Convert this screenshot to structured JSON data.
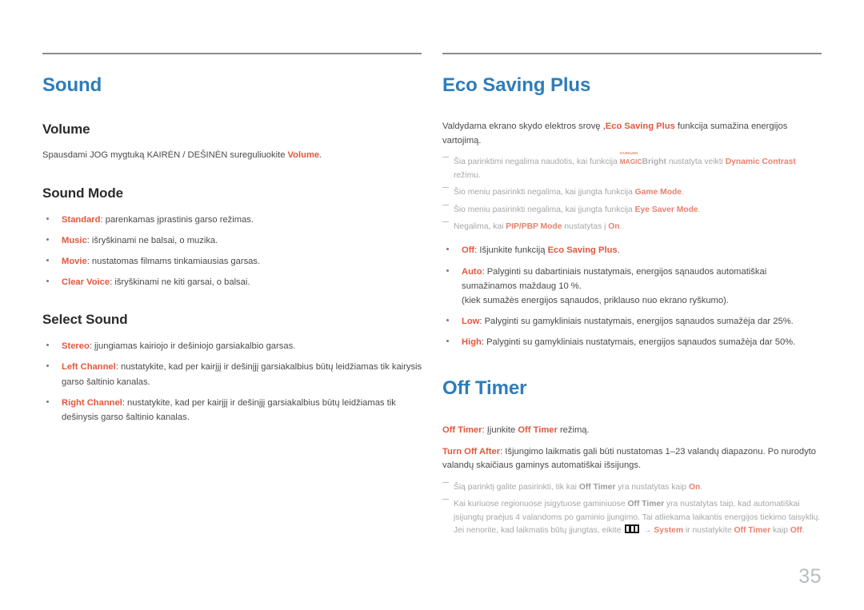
{
  "page": {
    "number": "35"
  },
  "left_column": {
    "section_title": "Sound",
    "volume": {
      "heading": "Volume",
      "body_pre": "Spausdami JOG mygtuką KAIRĖN / DEŠINĖN sureguliuokite ",
      "body_accent": "Volume",
      "body_post": "."
    },
    "sound_mode": {
      "heading": "Sound Mode",
      "items": [
        {
          "term": "Standard",
          "desc": ": parenkamas įprastinis garso režimas."
        },
        {
          "term": "Music",
          "desc": ": išryškinami ne balsai, o muzika."
        },
        {
          "term": "Movie",
          "desc": ": nustatomas filmams tinkamiausias garsas."
        },
        {
          "term": "Clear Voice",
          "desc": ": išryškinami ne kiti garsai, o balsai."
        }
      ]
    },
    "select_sound": {
      "heading": "Select Sound",
      "items": [
        {
          "term": "Stereo",
          "desc": ": įjungiamas kairiojo ir dešiniojo garsiakalbio garsas."
        },
        {
          "term": "Left Channel",
          "desc": ": nustatykite, kad per kairįjį ir dešinįjį garsiakalbius būtų leidžiamas tik kairysis garso šaltinio kanalas."
        },
        {
          "term": "Right Channel",
          "desc": ": nustatykite, kad per kairįjį ir dešinįjį garsiakalbius būtų leidžiamas tik dešinysis garso šaltinio kanalas."
        }
      ]
    }
  },
  "right_column": {
    "eco": {
      "section_title": "Eco Saving Plus",
      "intro_pre": "Valdydama ekrano skydo elektros srovę ,",
      "intro_accent": "Eco Saving Plus",
      "intro_post": " funkcija sumažina energijos vartojimą.",
      "notes": [
        {
          "parts": [
            {
              "t": "Šia parinktimi negalima naudotis, kai funkcija ",
              "style": "plain"
            },
            {
              "t": "MAGICBright",
              "style": "magic"
            },
            {
              "t": " nustatyta veikti ",
              "style": "plain"
            },
            {
              "t": "Dynamic Contrast",
              "style": "strong"
            },
            {
              "t": " režimu.",
              "style": "plain"
            }
          ]
        },
        {
          "parts": [
            {
              "t": "Šio meniu pasirinkti negalima, kai įjungta funkcija ",
              "style": "plain"
            },
            {
              "t": "Game Mode",
              "style": "accent"
            },
            {
              "t": ".",
              "style": "plain"
            }
          ]
        },
        {
          "parts": [
            {
              "t": "Šio meniu pasirinkti negalima, kai įjungta funkcija ",
              "style": "plain"
            },
            {
              "t": "Eye Saver Mode",
              "style": "accent"
            },
            {
              "t": ".",
              "style": "plain"
            }
          ]
        },
        {
          "parts": [
            {
              "t": "Negalima, kai ",
              "style": "plain"
            },
            {
              "t": "PIP/PBP Mode",
              "style": "accent"
            },
            {
              "t": " nustatytas į ",
              "style": "plain"
            },
            {
              "t": "On",
              "style": "accent"
            },
            {
              "t": ".",
              "style": "plain"
            }
          ]
        }
      ],
      "items": [
        {
          "term": "Off",
          "desc_pre": ": Išjunkite funkciją ",
          "desc_accent": "Eco Saving Plus",
          "desc_post": ".",
          "sub": ""
        },
        {
          "term": "Auto",
          "desc_pre": ": Palyginti su dabartiniais nustatymais, energijos sąnaudos automatiškai sumažinamos maždaug 10 %.",
          "desc_accent": "",
          "desc_post": "",
          "sub": "(kiek sumažės energijos sąnaudos, priklauso nuo ekrano ryškumo)."
        },
        {
          "term": "Low",
          "desc_pre": ": Palyginti su gamykliniais nustatymais, energijos sąnaudos sumažėja dar 25%.",
          "desc_accent": "",
          "desc_post": "",
          "sub": ""
        },
        {
          "term": "High",
          "desc_pre": ": Palyginti su gamykliniais nustatymais, energijos sąnaudos sumažėja dar 50%.",
          "desc_accent": "",
          "desc_post": "",
          "sub": ""
        }
      ]
    },
    "off_timer": {
      "section_title": "Off Timer",
      "para1": {
        "term": "Off Timer",
        "pre": ": Įjunkite ",
        "accent": "Off Timer",
        "post": " režimą."
      },
      "para2": {
        "term": "Turn Off After",
        "text": ": Išjungimo laikmatis gali būti nustatomas 1–23 valandų diapazonu. Po nurodyto valandų skaičiaus gaminys automatiškai išsijungs."
      },
      "notes": [
        {
          "parts": [
            {
              "t": "Šią parinktį galite pasirinkti, tik kai ",
              "style": "plain"
            },
            {
              "t": "Off Timer",
              "style": "strong"
            },
            {
              "t": " yra nustatytas kaip ",
              "style": "plain"
            },
            {
              "t": "On",
              "style": "accent"
            },
            {
              "t": ".",
              "style": "plain"
            }
          ]
        },
        {
          "parts": [
            {
              "t": "Kai kuriuose regionuose įsigytuose gaminiuose ",
              "style": "plain"
            },
            {
              "t": "Off Timer",
              "style": "strong"
            },
            {
              "t": " yra nustatytas taip, kad automatiškai įsijungtų praėjus 4 valandoms po gaminio įjungimo. Tai atliekama laikantis energijos tiekimo taisyklių. Jei nenorite, kad laikmatis būtų įjungtas, eikite ",
              "style": "plain"
            },
            {
              "t": "menu-icon",
              "style": "icon"
            },
            {
              "t": " → ",
              "style": "plain"
            },
            {
              "t": "System",
              "style": "accent"
            },
            {
              "t": " ir nustatykite ",
              "style": "plain"
            },
            {
              "t": "Off Timer",
              "style": "accent"
            },
            {
              "t": " kaip ",
              "style": "plain"
            },
            {
              "t": "Off",
              "style": "accent"
            },
            {
              "t": ".",
              "style": "plain"
            }
          ]
        }
      ]
    }
  },
  "colors": {
    "heading_blue": "#2e7dba",
    "accent_orange": "#e2573c",
    "note_gray": "#a7a7a7",
    "body_gray": "#4a4a4a",
    "page_number_gray": "#b9bcc0"
  }
}
